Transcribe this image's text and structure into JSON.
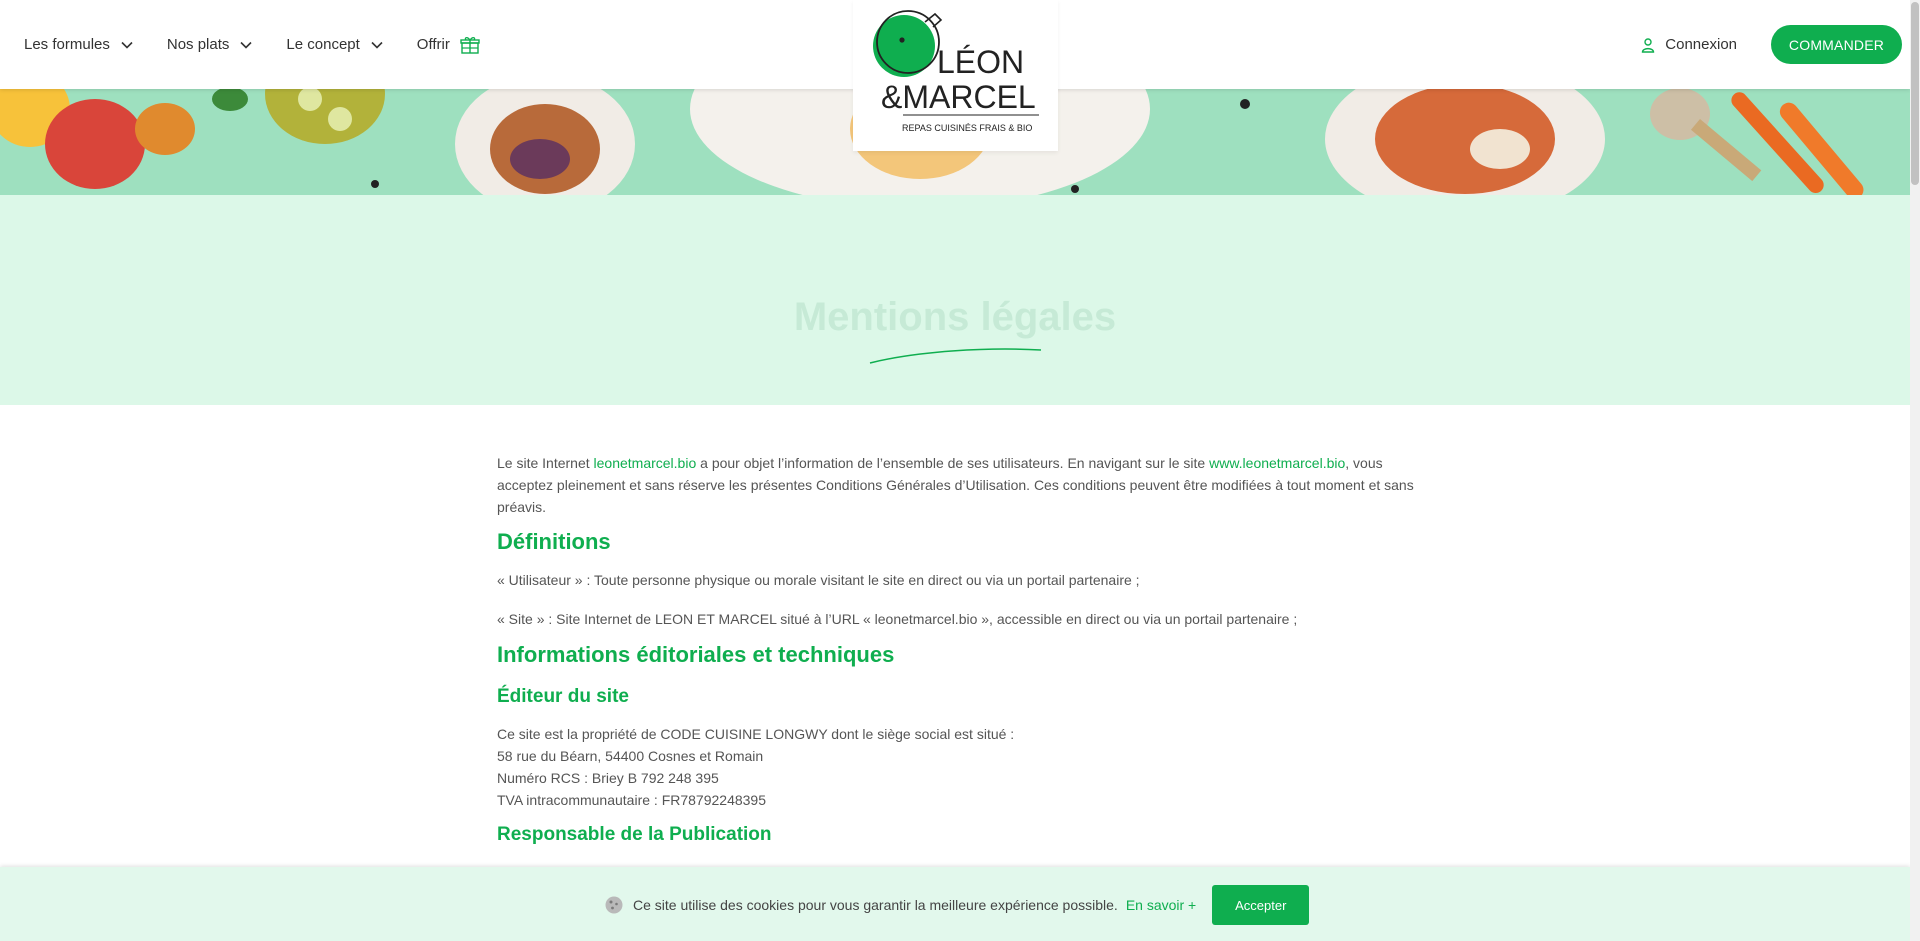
{
  "nav": {
    "items": [
      {
        "label": "Les formules"
      },
      {
        "label": "Nos plats"
      },
      {
        "label": "Le concept"
      },
      {
        "label": "Offrir"
      }
    ]
  },
  "logo": {
    "line1": "LÉON",
    "line2": "&MARCEL",
    "tagline": "REPAS CUISINÉS FRAIS & BIO"
  },
  "header_actions": {
    "login_label": "Connexion",
    "order_label": "COMMANDER"
  },
  "hero": {
    "title": "Mentions légales"
  },
  "content": {
    "intro_pre": "Le site Internet ",
    "intro_link1": "leonetmarcel.bio",
    "intro_mid": " a pour objet l’information de l’ensemble de ses utilisateurs. En navigant sur le site ",
    "intro_link2": "www.leonetmarcel.bio",
    "intro_post": ", vous acceptez pleinement et sans réserve les présentes Conditions Générales d’Utilisation. Ces conditions peuvent être modifiées à tout moment et sans préavis.",
    "h_definitions": "Définitions",
    "def_user": "« Utilisateur » : Toute personne physique ou morale visitant le site en direct ou via un portail partenaire ;",
    "def_site": "« Site » : Site Internet de LEON ET MARCEL situé à l’URL « leonetmarcel.bio », accessible en direct ou via un portail partenaire ;",
    "h_info": "Informations éditoriales et techniques",
    "h_editor": "Éditeur du site",
    "editor_lines": [
      "Ce site est la propriété de CODE CUISINE LONGWY dont le siège social est situé :",
      "58 rue du Béarn, 54400 Cosnes et Romain",
      "Numéro RCS : Briey B 792 248 395",
      "TVA intracommunautaire : FR78792248395"
    ],
    "h_publication": "Responsable de la Publication"
  },
  "cookie": {
    "text": "Ce site utilise des cookies pour vous garantir la meilleure expérience possible.",
    "link": "En savoir +",
    "accept": "Accepter"
  },
  "colors": {
    "accent": "#0fae4f",
    "hero_bg": "#dcf8e8",
    "banner_bg": "#9ee0bf"
  },
  "icons": [
    "chevron-down-icon",
    "gift-icon",
    "user-icon",
    "cookie-icon"
  ]
}
